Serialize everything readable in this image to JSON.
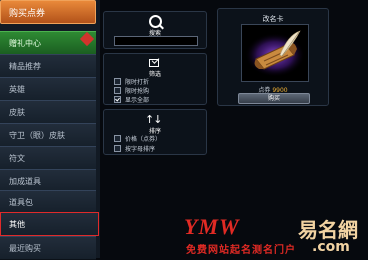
{
  "sidebar": {
    "top_tab": "购买点券",
    "items": [
      {
        "label": "赠礼中心"
      },
      {
        "label": "精品推荐"
      },
      {
        "label": "英雄"
      },
      {
        "label": "皮肤"
      },
      {
        "label": "守卫（眼）皮肤"
      },
      {
        "label": "符文"
      },
      {
        "label": "加成道具"
      },
      {
        "label": "道具包"
      },
      {
        "label": "其他"
      },
      {
        "label": "最近购买"
      }
    ],
    "selected": "其他"
  },
  "search": {
    "icon": "search-icon",
    "label": "搜索",
    "value": ""
  },
  "filter": {
    "icon": "checkbox-icon",
    "title": "筛选",
    "options": [
      {
        "label": "限时打折",
        "checked": false
      },
      {
        "label": "限时抢购",
        "checked": false
      },
      {
        "label": "显示全部",
        "checked": true
      }
    ]
  },
  "sort": {
    "icon": "sort-arrows-icon",
    "title": "排序",
    "options": [
      {
        "label": "价格（点券）",
        "checked": false
      },
      {
        "label": "按字母排序",
        "checked": false
      }
    ]
  },
  "item": {
    "name": "改名卡",
    "image": "rename-card-scroll-quill",
    "price_label": "点券",
    "price_value": "9900",
    "buy_label": "购买"
  },
  "watermark": {
    "logo": "YMW",
    "domain_cn": "易名網",
    "tagline": "免费网站起名测名门户",
    "domain_suffix": ".com"
  },
  "colors": {
    "accent_orange": "#d06a26",
    "gift_green": "#2e8a33",
    "selection_red": "#e02a2a",
    "price_gold": "#f2b233"
  }
}
